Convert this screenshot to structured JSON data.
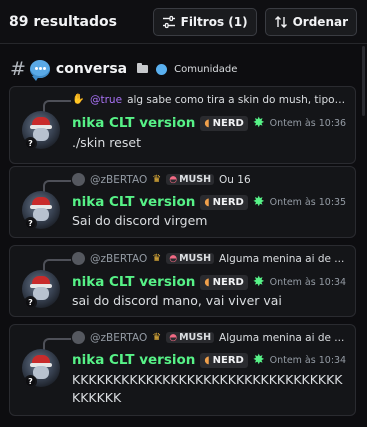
{
  "header": {
    "results": "89 resultados",
    "filters_label": "Filtros (1)",
    "sort_label": "Ordenar"
  },
  "channel": {
    "hash": "#",
    "name": "conversa",
    "community": "Comunidade"
  },
  "messages": [
    {
      "reply_user": "@true",
      "reply_user_color": "#a872f5",
      "reply_text": "alg sabe como tira a skin do mush, tipo, p...",
      "author": "nika CLT version",
      "tag": "NERD",
      "time": "Ontem às 10:36",
      "text": "./skin reset"
    },
    {
      "reply_user": "@zBERTAO",
      "reply_tag": "MUSH",
      "reply_text": "Ou 16",
      "author": "nika CLT version",
      "tag": "NERD",
      "time": "Ontem às 10:35",
      "text": "Sai do discord virgem"
    },
    {
      "reply_user": "@zBERTAO",
      "reply_tag": "MUSH",
      "reply_text": "Alguma menina ai de ...",
      "author": "nika CLT version",
      "tag": "NERD",
      "time": "Ontem às 10:34",
      "text": "sai do discord mano, vai viver vai"
    },
    {
      "reply_user": "@zBERTAO",
      "reply_tag": "MUSH",
      "reply_text": "Alguma menina ai de ...",
      "author": "nika CLT version",
      "tag": "NERD",
      "time": "Ontem às 10:34",
      "text": "KKKKKKKKKKKKKKKKKKKKKKKKKKKKKKKKKKKKKKK"
    }
  ]
}
